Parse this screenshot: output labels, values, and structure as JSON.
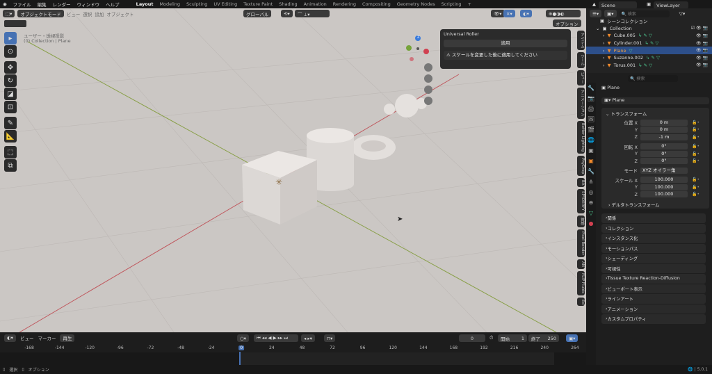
{
  "topbar": {
    "menus": [
      "ファイル",
      "編集",
      "レンダー",
      "ウィンドウ",
      "ヘルプ"
    ],
    "workspaces": [
      "Layout",
      "Modeling",
      "Sculpting",
      "UV Editing",
      "Texture Paint",
      "Shading",
      "Animation",
      "Rendering",
      "Compositing",
      "Geometry Nodes",
      "Scripting"
    ],
    "active_workspace": "Layout",
    "add": "+"
  },
  "scene": {
    "scene_name": "Scene",
    "view_layer": "ViewLayer"
  },
  "viewport": {
    "mode": "オブジェクトモード",
    "menus": [
      "ビュー",
      "選択",
      "追加",
      "オブジェクト"
    ],
    "orientation": "グローバル",
    "options": "オプション",
    "view_name": "ユーザー・透視投影",
    "collection_info": "(0) Collection | Plane",
    "gizmo": {
      "z": "Z"
    },
    "sidetabs": [
      "アイテム",
      "ツール",
      "ビュー",
      "アニメーション",
      "Better Lighting",
      "PhyDrop",
      "BA",
      "SPYDERFY",
      "質感",
      "Pixel Render",
      "AN",
      "FLIP Fluids",
      "Ed"
    ]
  },
  "roller": {
    "title": "Universal Roller",
    "apply": "適用",
    "warning": "スケールを変更した後に適用してください"
  },
  "outliner": {
    "search_placeholder": "検索",
    "scene_collection": "シーンコレクション",
    "collection": "Collection",
    "items": [
      "Cube.005",
      "Cylinder.001",
      "Plane",
      "Suzanne.002",
      "Torus.001"
    ],
    "selected": "Plane"
  },
  "properties": {
    "search_placeholder": "検索",
    "object_name": "Plane",
    "data_name": "Plane",
    "transform": "トランスフォーム",
    "location": {
      "label": "位置 X",
      "x": "0 m",
      "y": "0 m",
      "z": "-1 m"
    },
    "rotation": {
      "label": "回転 X",
      "x": "0°",
      "y": "0°",
      "z": "0°"
    },
    "mode": {
      "label": "モード",
      "value": "XYZ オイラー角"
    },
    "scale": {
      "label": "スケール X",
      "x": "100.000",
      "y": "100.000",
      "z": "100.000"
    },
    "axis": {
      "y": "Y",
      "z": "Z"
    },
    "delta": "デルタトランスフォーム",
    "panels": [
      "関係",
      "コレクション",
      "インスタンス化",
      "モーションパス",
      "シェーディング",
      "可視性",
      "Tissue Texture Reaction-Diffusion",
      "ビューポート表示",
      "ラインアート",
      "アニメーション",
      "カスタムプロパティ"
    ]
  },
  "timeline": {
    "menus": [
      "ビュー",
      "マーカー",
      "再生"
    ],
    "current_frame": "0",
    "start_label": "開始",
    "start": "1",
    "end_label": "終了",
    "end": "250",
    "ticks": [
      "-168",
      "-144",
      "-120",
      "-96",
      "-72",
      "-48",
      "-24",
      "0",
      "24",
      "48",
      "72",
      "96",
      "120",
      "144",
      "168",
      "192",
      "216",
      "240",
      "264"
    ]
  },
  "status": {
    "select": "選択",
    "options": "オプション",
    "version": "5.0.1"
  },
  "colors": {
    "accent": "#4772b3",
    "selected_row": "#2d4f8a",
    "x_axis": "#c0595f",
    "y_axis": "#8aa04a"
  }
}
